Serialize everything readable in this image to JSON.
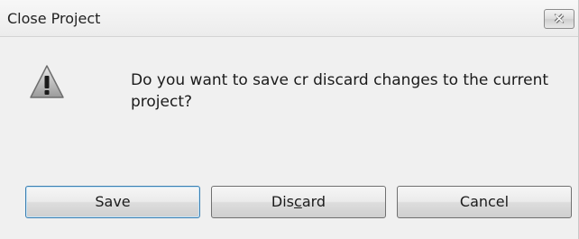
{
  "window": {
    "title": "Close Project",
    "close_glyph": "✕"
  },
  "message": {
    "icon": "warning-icon",
    "text": "Do you want to save cr discard changes to the current project?"
  },
  "buttons": {
    "save_label": "Save",
    "discard_label_prefix": "Dis",
    "discard_label_mnemonic": "c",
    "discard_label_suffix": "ard",
    "cancel_label": "Cancel"
  },
  "colors": {
    "dialog_bg": "#f0f0f0",
    "default_button_border": "#3c7fb1"
  }
}
